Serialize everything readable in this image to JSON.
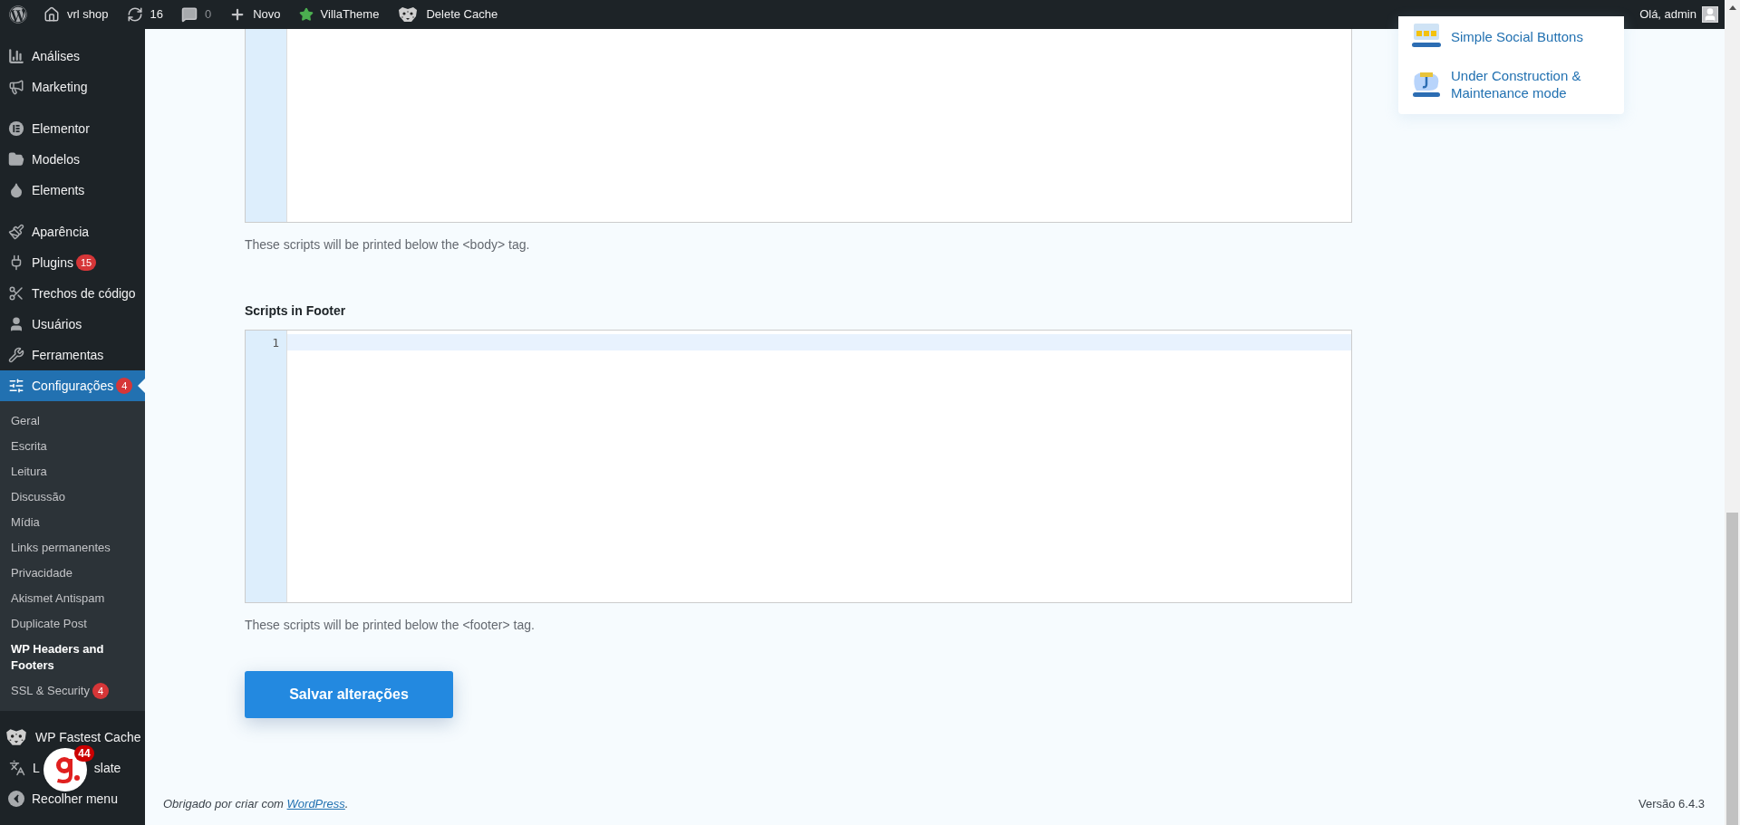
{
  "admin_bar": {
    "items": [
      {
        "kind": "wp"
      },
      {
        "kind": "home",
        "label": "vrl shop"
      },
      {
        "kind": "updates",
        "label": "16"
      },
      {
        "kind": "comments",
        "label": "0"
      },
      {
        "kind": "new",
        "label": "Novo"
      },
      {
        "kind": "star",
        "label": "VillaTheme"
      },
      {
        "kind": "cache",
        "label": "Delete Cache"
      }
    ],
    "greeting": "Olá, admin"
  },
  "sidebar": {
    "groups": [
      {
        "items": [
          {
            "kind": "chart",
            "label": "Análises",
            "selected": false
          },
          {
            "kind": "megaphone",
            "label": "Marketing",
            "selected": false
          }
        ]
      },
      {
        "items": [
          {
            "kind": "elementor",
            "label": "Elementor",
            "selected": false
          },
          {
            "kind": "folder",
            "label": "Modelos",
            "selected": false
          },
          {
            "kind": "leaf",
            "label": "Elements",
            "selected": false
          }
        ]
      },
      {
        "items": [
          {
            "kind": "brush",
            "label": "Aparência",
            "selected": false
          },
          {
            "kind": "plug",
            "label": "Plugins",
            "badge": "15",
            "selected": false
          },
          {
            "kind": "scissors",
            "label": "Trechos de código",
            "selected": false
          },
          {
            "kind": "user",
            "label": "Usuários",
            "selected": false
          },
          {
            "kind": "wrench",
            "label": "Ferramentas",
            "selected": false
          },
          {
            "kind": "sliders",
            "label": "Configurações",
            "badge": "4",
            "selected": true,
            "submenu": [
              {
                "label": "Geral",
                "selected": false
              },
              {
                "label": "Escrita",
                "selected": false
              },
              {
                "label": "Leitura",
                "selected": false
              },
              {
                "label": "Discussão",
                "selected": false
              },
              {
                "label": "Mídia",
                "selected": false
              },
              {
                "label": "Links permanentes",
                "selected": false
              },
              {
                "label": "Privacidade",
                "selected": false
              },
              {
                "label": "Akismet Antispam",
                "selected": false
              },
              {
                "label": "Duplicate Post",
                "selected": false
              },
              {
                "label": "WP Headers and Footers",
                "selected": true
              },
              {
                "label": "SSL & Security",
                "badge": "4",
                "selected": false
              }
            ]
          }
        ]
      },
      {
        "items": [
          {
            "kind": "cheetah",
            "label": "WP Fastest Cache",
            "selected": false
          },
          {
            "kind": "translate",
            "label_parts": [
              "L",
              "slate"
            ],
            "selected": false
          },
          {
            "kind": "collapse",
            "label": "Recolher menu",
            "selected": false
          }
        ]
      }
    ],
    "floating_badge": {
      "count": "44"
    }
  },
  "editors": [
    {
      "note": "These scripts will be printed below the <body> tag."
    },
    {
      "heading": "Scripts in Footer",
      "line_numbers": [
        "1"
      ],
      "note": "These scripts will be printed below the <footer> tag."
    }
  ],
  "save_button": "Salvar alterações",
  "side_card": {
    "items": [
      {
        "kind": "social",
        "label": "Simple Social Buttons"
      },
      {
        "kind": "construction",
        "label": "Under Construction & Maintenance mode"
      }
    ]
  },
  "footer": {
    "prefix": "Obrigado por criar com ",
    "link": "WordPress",
    "suffix": ".",
    "version": "Versão 6.4.3"
  }
}
